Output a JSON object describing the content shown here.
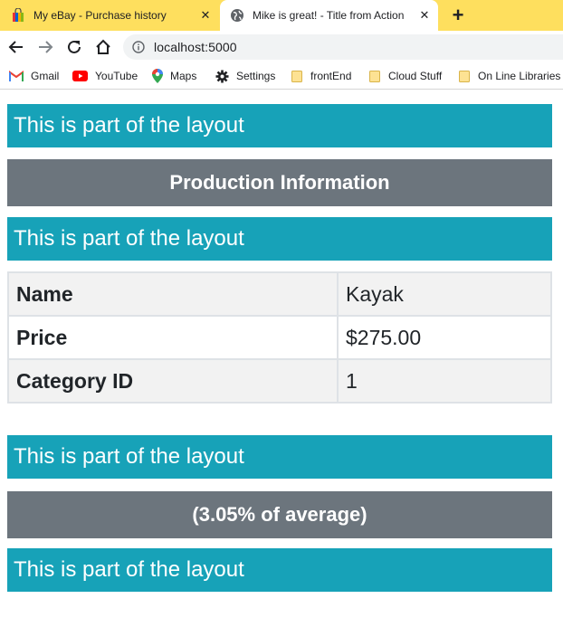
{
  "browser": {
    "tabs": [
      {
        "title": "My eBay - Purchase history",
        "active": false,
        "icon": "shopping-bag-icon"
      },
      {
        "title": "Mike is great! - Title from Action",
        "active": true,
        "icon": "globe-icon"
      }
    ],
    "new_tab_icon": "plus-icon",
    "url": "localhost:5000",
    "bookmarks": [
      {
        "label": "Gmail",
        "icon": "gmail-icon"
      },
      {
        "label": "YouTube",
        "icon": "youtube-icon"
      },
      {
        "label": "Maps",
        "icon": "maps-icon"
      },
      {
        "label": "Settings",
        "icon": "gear-icon"
      },
      {
        "label": "frontEnd",
        "icon": "folder-icon"
      },
      {
        "label": "Cloud Stuff",
        "icon": "folder-icon"
      },
      {
        "label": "On Line Libraries",
        "icon": "folder-icon"
      }
    ]
  },
  "page": {
    "layout_text": "This is part of the layout",
    "section_heading": "Production Information",
    "product": {
      "rows": [
        {
          "label": "Name",
          "value": "Kayak"
        },
        {
          "label": "Price",
          "value": "$275.00"
        },
        {
          "label": "Category ID",
          "value": "1"
        }
      ]
    },
    "average_note": "(3.05% of average)"
  },
  "colors": {
    "tab_strip": "#fedf5e",
    "info_bar": "#17a2b8",
    "dark_bar": "#6c757d"
  }
}
